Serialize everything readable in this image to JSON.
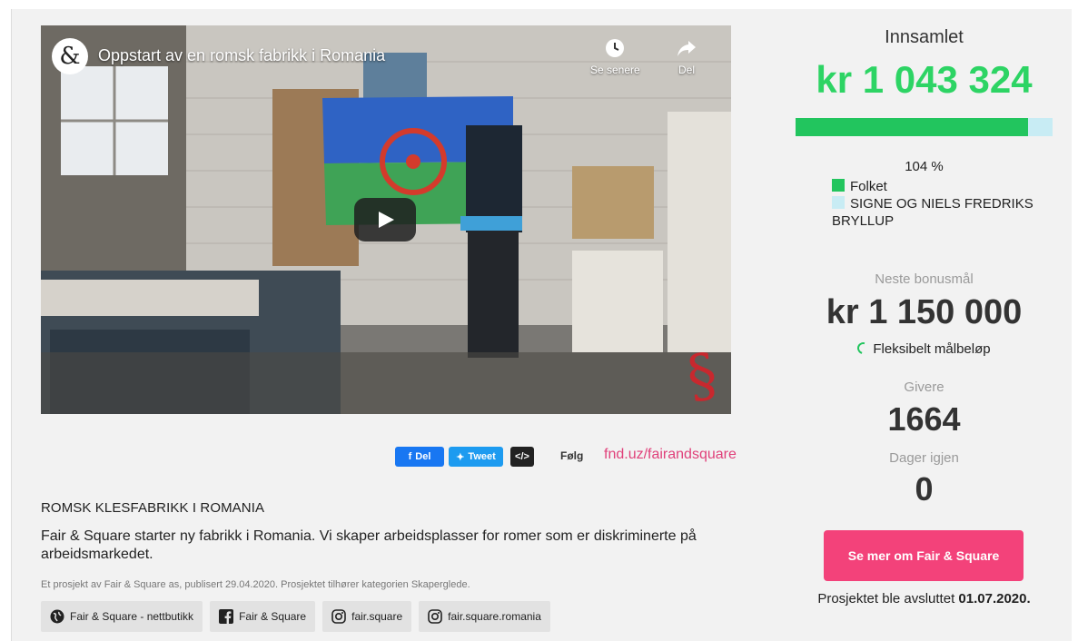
{
  "video": {
    "title": "Oppstart av en romsk fabrikk i Romania",
    "channel_logo_glyph": "&",
    "watch_later_label": "Se senere",
    "share_label": "Del",
    "icons": [
      "clock-icon",
      "share-arrow-icon",
      "play-icon"
    ]
  },
  "share": {
    "facebook_label": "Del",
    "tweet_label": "Tweet",
    "embed_label": "</>",
    "follow_label": "Følg",
    "short_link": "fnd.uz/fairandsquare"
  },
  "project": {
    "category_title": "ROMSK KLESFABRIKK I ROMANIA",
    "description": "Fair & Square starter ny fabrikk i Romania. Vi skaper arbeidsplasser for romer som er diskriminerte på arbeidsmarkedet.",
    "meta": "Et prosjekt av Fair & Square as, publisert 29.04.2020. Prosjektet tilhører kategorien Skaperglede.",
    "links": [
      {
        "label": "Fair & Square - nettbutikk",
        "icon": "globe-icon"
      },
      {
        "label": "Fair & Square",
        "icon": "facebook-icon"
      },
      {
        "label": "fair.square",
        "icon": "instagram-icon"
      },
      {
        "label": "fair.square.romania",
        "icon": "instagram-icon"
      }
    ]
  },
  "funding": {
    "raised_label": "Innsamlet",
    "raised_amount": "kr 1 043 324",
    "progress_fraction": 0.905,
    "percent_text": "104 %",
    "legend": [
      {
        "label": "Folket",
        "color": "#22c55e"
      },
      {
        "label": "SIGNE OG NIELS FREDRIKS BRYLLUP",
        "color": "#c8ecf4"
      }
    ],
    "next_goal_label": "Neste bonusmål",
    "next_goal_amount": "kr 1 150 000",
    "flexible_label": "Fleksibelt målbeløp",
    "givers_label": "Givere",
    "givers_count": "1664",
    "days_left_label": "Dager igjen",
    "days_left": "0",
    "cta_label": "Se mer om Fair & Square",
    "ended_prefix": "Prosjektet ble avsluttet",
    "ended_date": "01.07.2020."
  },
  "colors": {
    "accent_green": "#2dd464",
    "cta_pink": "#f3427a",
    "link_pink": "#e0407a"
  }
}
